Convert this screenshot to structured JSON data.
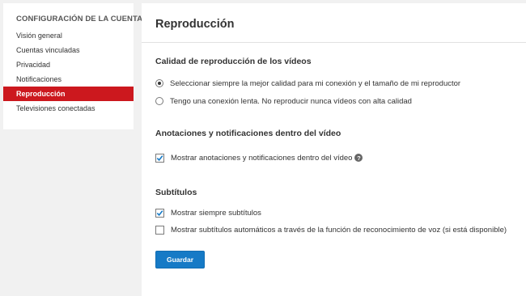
{
  "sidebar": {
    "heading": "CONFIGURACIÓN DE LA CUENTA",
    "items": [
      {
        "label": "Visión general"
      },
      {
        "label": "Cuentas vinculadas"
      },
      {
        "label": "Privacidad"
      },
      {
        "label": "Notificaciones"
      },
      {
        "label": "Reproducción"
      },
      {
        "label": "Televisiones conectadas"
      }
    ],
    "active_item": "Reproducción"
  },
  "main": {
    "title": "Reproducción",
    "quality": {
      "title": "Calidad de reproducción de los vídeos",
      "options": [
        {
          "label": "Seleccionar siempre la mejor calidad para mi conexión y el tamaño de mi reproductor",
          "checked": true
        },
        {
          "label": "Tengo una conexión lenta. No reproducir nunca vídeos con alta calidad",
          "checked": false
        }
      ]
    },
    "annotations": {
      "title": "Anotaciones y notificaciones dentro del vídeo",
      "option": {
        "label": "Mostrar anotaciones y notificaciones dentro del vídeo",
        "checked": true
      },
      "help_icon": "question-icon",
      "help_glyph": "?"
    },
    "subtitles": {
      "title": "Subtítulos",
      "options": [
        {
          "label": "Mostrar siempre subtítulos",
          "checked": true
        },
        {
          "label": "Mostrar subtítulos automáticos a través de la función de reconocimiento de voz (si está disponible)",
          "checked": false
        }
      ]
    },
    "save_label": "Guardar"
  },
  "colors": {
    "accent": "#cc181e",
    "button": "#167ac6",
    "check": "#167ac6"
  }
}
